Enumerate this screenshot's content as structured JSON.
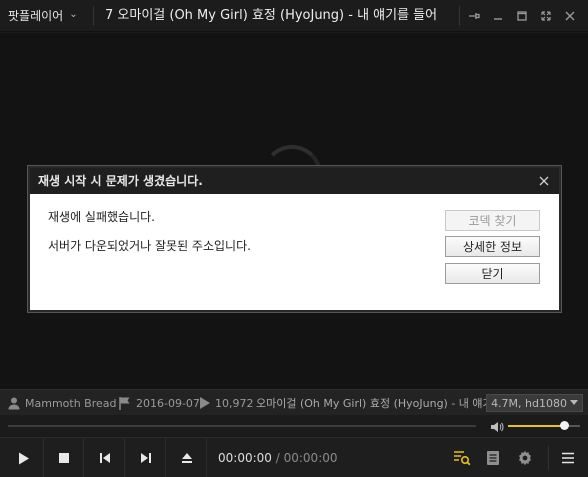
{
  "app": {
    "menu_label": "팟플레이어",
    "window_title": "7 오마이걸 (Oh My Girl) 효정 (HyoJung) - 내 얘기를 들어"
  },
  "dialog": {
    "title": "재생 시작 시 문제가 생겼습니다.",
    "message_line1": "재생에 실패했습니다.",
    "message_line2": "서버가 다운되었거나 잘못된 주소입니다.",
    "codec_button": "코덱 찾기",
    "details_button": "상세한 정보",
    "close_button": "닫기"
  },
  "info": {
    "uploader": "Mammoth Bread",
    "date": "2016-09-07",
    "views": "10,972",
    "title": "오마이걸 (Oh My Girl) 효정 (HyoJung) - 내 얘기를 들어",
    "quality": "4.7M, hd1080"
  },
  "playback": {
    "current_time": "00:00:00",
    "separator": "/",
    "total_time": "00:00:00",
    "volume_level": 0.78
  },
  "colors": {
    "accent": "#e6c21e",
    "dialog_header": "#1f1f1f"
  }
}
